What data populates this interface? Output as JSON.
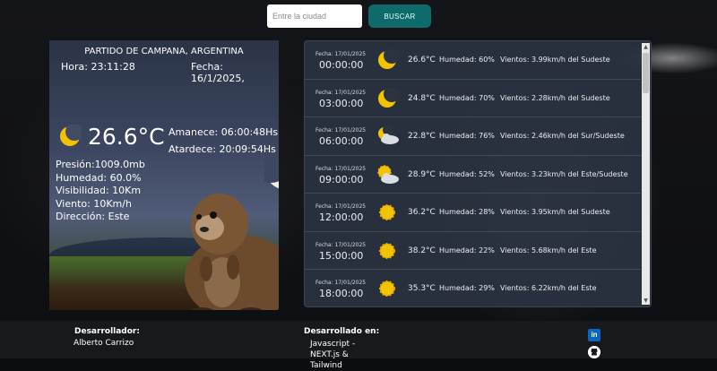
{
  "search": {
    "placeholder": "Entre la ciudad",
    "button_label": "BUSCAR"
  },
  "current": {
    "location": "PARTIDO DE CAMPANA, ARGENTINA",
    "hora": "Hora: 23:11:28",
    "fecha": "Fecha: 16/1/2025,",
    "icon": "moon-icon",
    "temp": "26.6°C",
    "amanece": "Amanece: 06:00:48Hs",
    "atardece": "Atardece: 20:09:54Hs",
    "presion": "Presión:1009.0mb",
    "humedad": "Humedad: 60.0%",
    "visibilidad": "Visibilidad: 10Km",
    "viento": "Viento: 10Km/h",
    "direccion": "Dirección: Este"
  },
  "forecast": [
    {
      "date": "Fecha: 17/01/2025",
      "time": "00:00:00",
      "icon": "moon-icon",
      "temp": "26.6°C",
      "humidity": "Humedad: 60%",
      "wind": "Vientos: 3.99km/h del Sudeste"
    },
    {
      "date": "Fecha: 17/01/2025",
      "time": "03:00:00",
      "icon": "moon-icon",
      "temp": "24.8°C",
      "humidity": "Humedad: 70%",
      "wind": "Vientos: 2.28km/h del Sudeste"
    },
    {
      "date": "Fecha: 17/01/2025",
      "time": "06:00:00",
      "icon": "moon-cloud-icon",
      "temp": "22.8°C",
      "humidity": "Humedad: 76%",
      "wind": "Vientos: 2.46km/h del Sur/Sudeste"
    },
    {
      "date": "Fecha: 17/01/2025",
      "time": "09:00:00",
      "icon": "sun-cloud-icon",
      "temp": "28.9°C",
      "humidity": "Humedad: 52%",
      "wind": "Vientos: 3.23km/h del Este/Sudeste"
    },
    {
      "date": "Fecha: 17/01/2025",
      "time": "12:00:00",
      "icon": "sun-icon",
      "temp": "36.2°C",
      "humidity": "Humedad: 28%",
      "wind": "Vientos: 3.95km/h del Sudeste"
    },
    {
      "date": "Fecha: 17/01/2025",
      "time": "15:00:00",
      "icon": "sun-icon",
      "temp": "38.2°C",
      "humidity": "Humedad: 22%",
      "wind": "Vientos: 5.68km/h del Este"
    },
    {
      "date": "Fecha: 17/01/2025",
      "time": "18:00:00",
      "icon": "sun-icon",
      "temp": "35.3°C",
      "humidity": "Humedad: 29%",
      "wind": "Vientos: 6.22km/h del Este"
    }
  ],
  "footer": {
    "dev_title": "Desarrollador:",
    "dev_name": "Alberto Carrizo",
    "stack_title": "Desarrollado en:",
    "stack_text": "Javascript - NEXT.js & Tailwind",
    "linkedin_label": "in"
  },
  "colors": {
    "accent": "#0e6b6b",
    "panel": "#2a3342",
    "footer": "#18191c"
  }
}
